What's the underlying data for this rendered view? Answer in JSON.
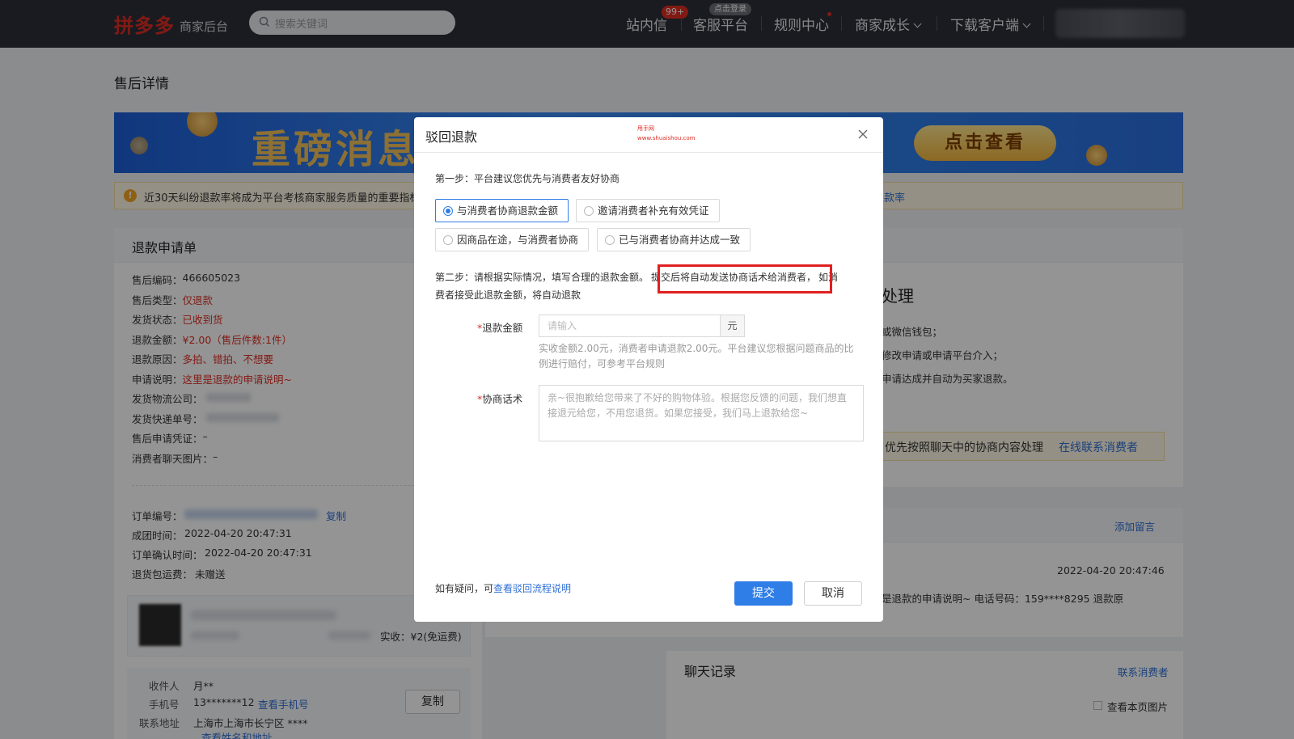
{
  "header": {
    "logo": "拼多多",
    "logo_sub": "商家后台",
    "search_placeholder": "搜索关键词",
    "nav": {
      "messages": "站内信",
      "messages_badge": "99+",
      "service": "客服平台",
      "service_badge": "点击登录",
      "rules": "规则中心",
      "growth": "商家成长",
      "download": "下载客户端"
    }
  },
  "page": {
    "title": "售后详情",
    "banner": {
      "headline": "重磅消息",
      "button": "点击查看"
    },
    "notice": {
      "text": "近30天纠纷退款率将成为平台考核商家服务质量的重要指标",
      "link": "纷退款率"
    }
  },
  "refund_card": {
    "title": "退款申请单",
    "rows": [
      {
        "label": "售后编码：",
        "value": "466605023",
        "tone": "normal"
      },
      {
        "label": "售后类型：",
        "value": "仅退款",
        "tone": "red"
      },
      {
        "label": "发货状态：",
        "value": "已收到货",
        "tone": "red"
      },
      {
        "label": "退款金额：",
        "value": "¥2.00（售后件数:1件）",
        "tone": "red"
      },
      {
        "label": "退款原因：",
        "value": "多拍、错拍、不想要",
        "tone": "red"
      },
      {
        "label": "申请说明：",
        "value": "这里是退款的申请说明~",
        "tone": "red"
      },
      {
        "label": "发货物流公司：",
        "value": "",
        "tone": "blur"
      },
      {
        "label": "发货快递单号：",
        "value": "",
        "tone": "blur"
      },
      {
        "label": "售后申请凭证：",
        "value": "–",
        "tone": "normal"
      },
      {
        "label": "消费者聊天图片：",
        "value": "–",
        "tone": "normal"
      }
    ],
    "order": {
      "order_no_label": "订单编号：",
      "copy": "复制",
      "group_time_label": "成团时间：",
      "group_time": "2022-04-20 20:47:31",
      "confirm_time_label": "订单确认时间：",
      "confirm_time": "2022-04-20 20:47:31",
      "shipping_label": "退货包运费：",
      "shipping": "未赠送"
    },
    "product_paid": "实收：¥2(免运费)",
    "receiver": {
      "name_label": "收件人",
      "name": "月**",
      "phone_label": "手机号",
      "phone": "13*******12",
      "view_phone": "查看手机号",
      "address_label": "联系地址",
      "address": "上海市上海市长宁区 ****",
      "view_address": "查看姓名和地址",
      "copy_button": "复制"
    }
  },
  "right_panel": {
    "heading_fragment": "处理",
    "line1": "或微信钱包；",
    "line2": "修改申请或申请平台介入；",
    "line3": "申请达成并自动为买家退款。",
    "tip": "优先按照聊天中的协商内容处理",
    "tip_link": "在线联系消费者",
    "add_note": "添加留言",
    "log_time": "2022-04-20 20:47:46",
    "log_text": "是退款的申请说明~ 电话号码：159****8295 退款原",
    "chat_title": "聊天记录",
    "contact": "联系消费者",
    "view_images": "查看本页图片"
  },
  "modal": {
    "title": "驳回退款",
    "watermark_1": "甩手网",
    "watermark_2": "www.shuaishou.com",
    "step1": "第一步：平台建议您优先与消费者友好协商",
    "options": [
      "与消费者协商退款金额",
      "邀请消费者补充有效凭证",
      "因商品在途，与消费者协商",
      "已与消费者协商并达成一致"
    ],
    "selected_index": 0,
    "step2_a": "第二步：请根据实际情况，填写合理的退款金额。",
    "step2_highlight": "提交后将自动发送协商话术给消费者，",
    "step2_b": "如消",
    "step2_c": "费者接受此退款金额，将自动退款",
    "amount_label": "退款金额",
    "amount_placeholder": "请输入",
    "amount_unit": "元",
    "amount_hint": "实收金额2.00元，消费者申请退款2.00元。平台建议您根据问题商品的比例进行赔付，可参考平台规则",
    "script_label": "协商话术",
    "script_text": "亲~很抱歉给您带来了不好的购物体验。根据您反馈的问题，我们想直接退元给您，不用您退货。如果您接受，我们马上退款给您~",
    "footer_text": "如有疑问，可",
    "footer_link": "查看驳回流程说明",
    "submit": "提交",
    "cancel": "取消"
  },
  "colors": {
    "brand": "#e02e24",
    "primary": "#2f7de6",
    "highlight_box": "#e02020",
    "topbar": "#2c2f38"
  }
}
